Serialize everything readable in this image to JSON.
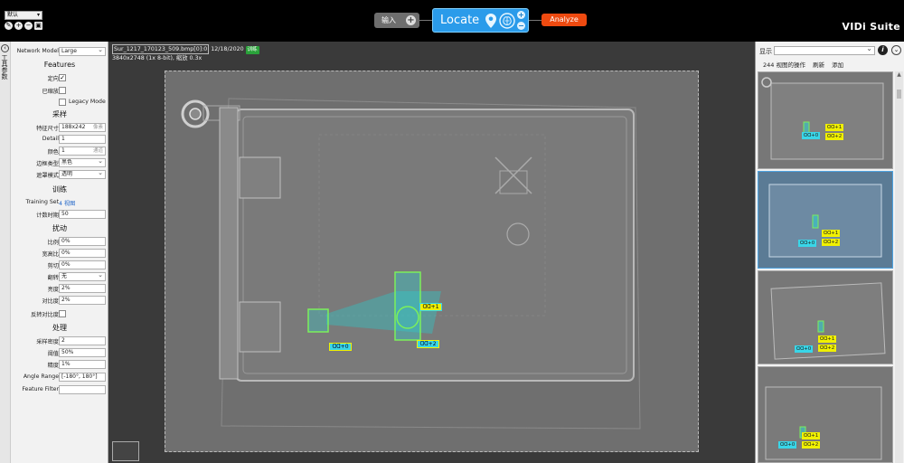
{
  "workspace": {
    "selected": "默认"
  },
  "topbar": {
    "input_label": "输入",
    "locate_label": "Locate",
    "analyze_label": "Analyze",
    "brand": "VIDi Suite",
    "colors": {
      "locate": "#2a9bea",
      "analyze": "#ee4a10",
      "input": "#6e6e6e"
    }
  },
  "left_panel": {
    "tab_label": "工具参数",
    "network_model_label": "Network Model",
    "network_model_value": "Large",
    "features_heading": "Features",
    "oriented_label": "定向",
    "scaled_label": "已缩放",
    "legacy_mode_label": "Legacy Mode",
    "sampling_heading": "采样",
    "feature_size_label": "特征尺寸",
    "feature_size_value": "188x242",
    "feature_size_unit": "像素",
    "detail_label": "Detail",
    "detail_value": "1",
    "color_label": "颜色",
    "color_value": "1",
    "color_unit": "通道",
    "border_type_label": "边框类型",
    "border_type_value": "黑色",
    "mask_mode_label": "遮罩模式",
    "mask_mode_value": "透明",
    "training_heading": "训练",
    "training_set_label": "Training Set",
    "training_set_value": "4 视图",
    "epochs_label": "计数时期",
    "epochs_value": "50",
    "perturbation_heading": "扰动",
    "scale_label": "比例",
    "scale_value": "0%",
    "aspect_label": "宽高比",
    "aspect_value": "0%",
    "shear_label": "剪切",
    "shear_value": "0%",
    "flip_label": "翻转",
    "flip_value": "无",
    "brightness_label": "亮度",
    "brightness_value": "2%",
    "contrast_label": "对比度",
    "contrast_value": "2%",
    "inverse_contrast_label": "反转对比度",
    "processing_heading": "处理",
    "sampling_density_label": "采样密度",
    "sampling_density_value": "2",
    "threshold_label": "阈值",
    "threshold_value": "50%",
    "precision_label": "精度",
    "precision_value": "1%",
    "angle_range_label": "Angle Range",
    "angle_range_value": "[-180°, 180°]",
    "feature_filter_label": "Feature Filter",
    "feature_filter_value": ""
  },
  "image_view": {
    "file_name": "Sur_1217_170123_509.bmp[0]:0",
    "date": "12/18/2020",
    "badge": "训练",
    "badge_color": "#2aa23a",
    "dims": "3840x2748 (1x 8-bit), 缩放 0.3x",
    "markers": [
      "0",
      "1",
      "2"
    ]
  },
  "right_panel": {
    "show_label": "显示",
    "views_label": "244 视图的操作",
    "refresh_label": "刷新",
    "add_label": "添加",
    "thumb_markers": [
      "0",
      "1",
      "2"
    ]
  }
}
